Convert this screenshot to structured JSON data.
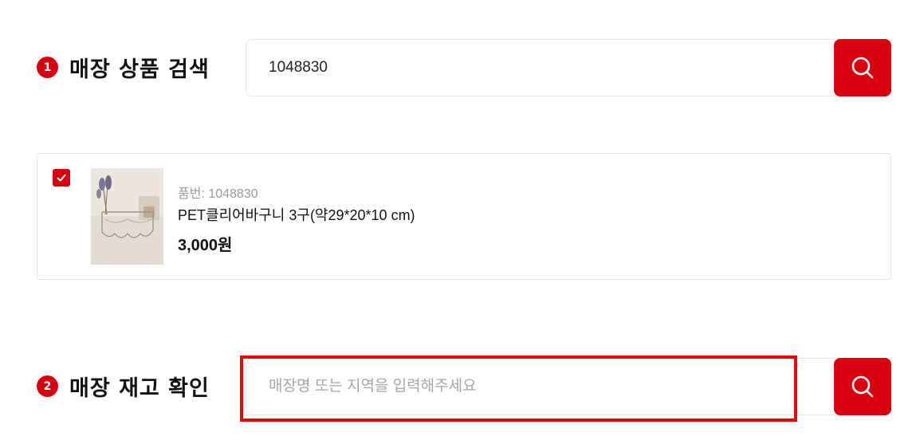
{
  "section1": {
    "number": "1",
    "title": "매장 상품 검색",
    "search_value": "1048830",
    "search_placeholder": ""
  },
  "product": {
    "checked": true,
    "code_label": "품번: 1048830",
    "name": "PET클리어바구니 3구(약29*20*10 cm)",
    "price": "3,000원",
    "image": "clear-basket-product-photo"
  },
  "section2": {
    "number": "2",
    "title": "매장 재고 확인",
    "search_value": "",
    "search_placeholder": "매장명 또는 지역을 입력해주세요"
  },
  "icons": {
    "search": "search-icon",
    "check": "check-icon"
  },
  "colors": {
    "accent": "#d8000f",
    "highlight": "#ee0000",
    "muted_text": "#9a9a9a",
    "border": "#e4e4e4"
  }
}
